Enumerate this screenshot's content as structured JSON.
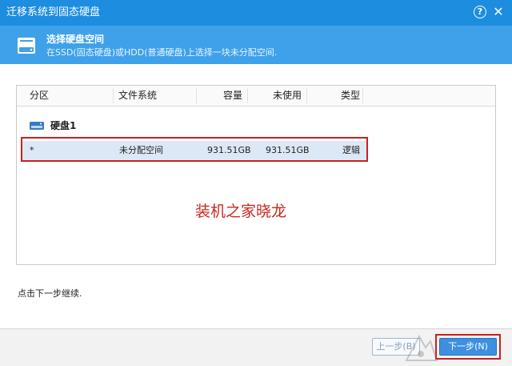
{
  "window": {
    "title": "迁移系统到固态硬盘",
    "help_label": "?",
    "close_label": "✕"
  },
  "header": {
    "title": "选择硬盘空间",
    "subtitle": "在SSD(固态硬盘)或HDD(普通硬盘)上选择一块未分配空间."
  },
  "table": {
    "columns": [
      "分区",
      "文件系统",
      "容量",
      "未使用",
      "类型"
    ],
    "disk_label": "硬盘1",
    "rows": [
      {
        "partition": "*",
        "filesystem": "未分配空间",
        "capacity": "931.51GB",
        "unused": "931.51GB",
        "type": "逻辑"
      }
    ]
  },
  "watermark": "装机之家晓龙",
  "hint": "点击下一步继续.",
  "buttons": {
    "back": "上一步(B)",
    "next": "下一步(N)"
  },
  "colors": {
    "titlebar": "#1d8de0",
    "header_band": "#3ea1ea",
    "selected_row": "#dde8f6",
    "annotation_red": "#cc1f1f",
    "next_button": "#3d8fe0"
  },
  "icons": {
    "header": "hard-disk-icon",
    "disk": "hard-disk-icon",
    "help": "help-icon",
    "close": "close-icon",
    "footer_logo": "logo-icon"
  }
}
